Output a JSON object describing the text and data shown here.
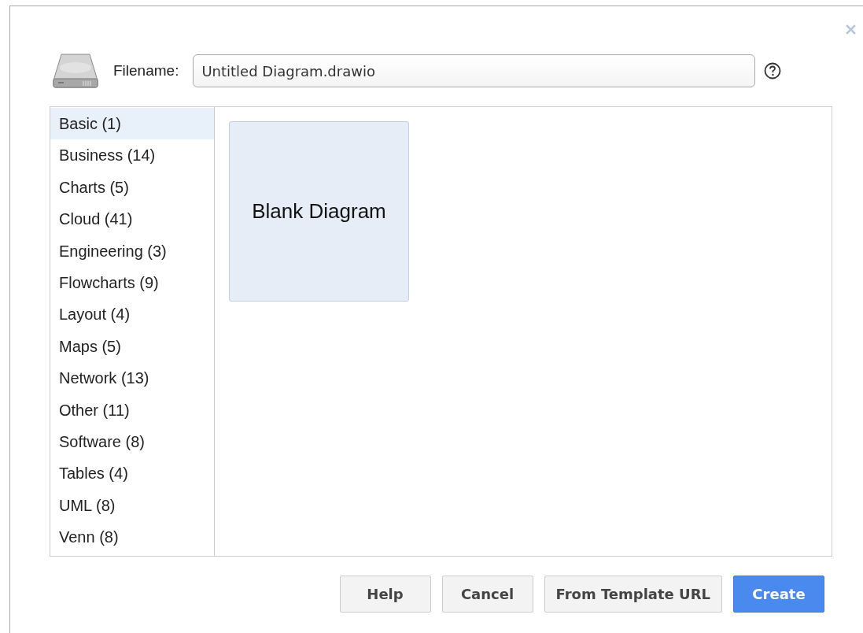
{
  "filename": {
    "label": "Filename:",
    "value": "Untitled Diagram.drawio"
  },
  "categories": [
    {
      "label": "Basic (1)",
      "selected": true
    },
    {
      "label": "Business (14)",
      "selected": false
    },
    {
      "label": "Charts (5)",
      "selected": false
    },
    {
      "label": "Cloud (41)",
      "selected": false
    },
    {
      "label": "Engineering (3)",
      "selected": false
    },
    {
      "label": "Flowcharts (9)",
      "selected": false
    },
    {
      "label": "Layout (4)",
      "selected": false
    },
    {
      "label": "Maps (5)",
      "selected": false
    },
    {
      "label": "Network (13)",
      "selected": false
    },
    {
      "label": "Other (11)",
      "selected": false
    },
    {
      "label": "Software (8)",
      "selected": false
    },
    {
      "label": "Tables (4)",
      "selected": false
    },
    {
      "label": "UML (8)",
      "selected": false
    },
    {
      "label": "Venn (8)",
      "selected": false
    }
  ],
  "templates": [
    {
      "label": "Blank Diagram"
    }
  ],
  "buttons": [
    {
      "label": "Help",
      "kind": "default"
    },
    {
      "label": "Cancel",
      "kind": "default"
    },
    {
      "label": "From Template URL",
      "kind": "default"
    },
    {
      "label": "Create",
      "kind": "primary"
    }
  ]
}
